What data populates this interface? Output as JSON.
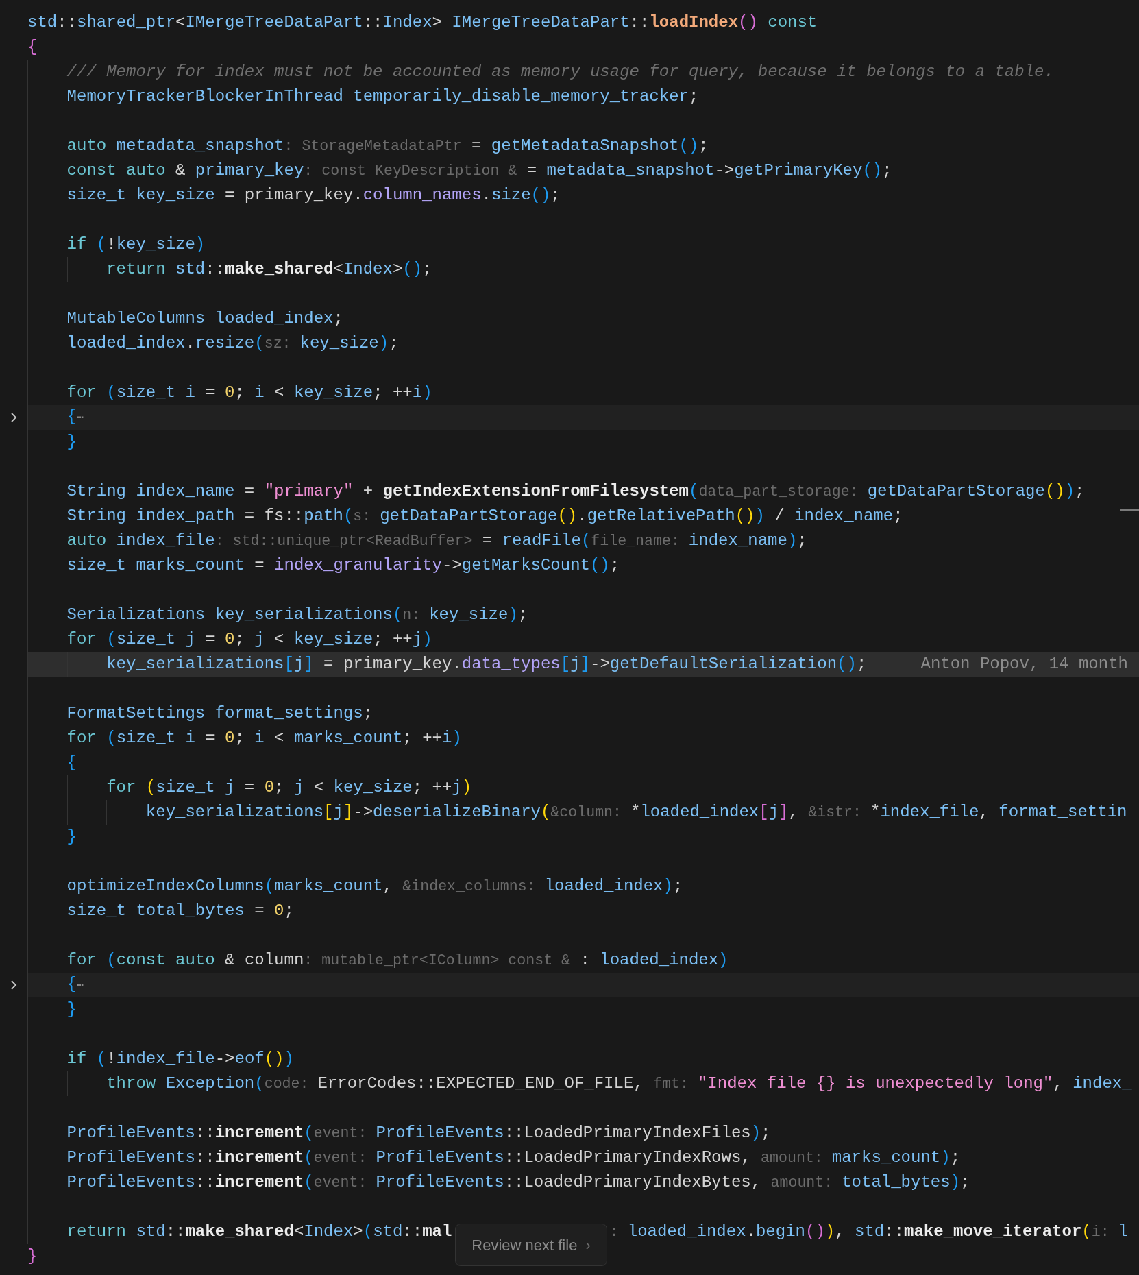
{
  "editor": {
    "lines": [
      {
        "kind": "code",
        "current": false,
        "tokens": [
          {
            "text": "std",
            "kind": "id"
          },
          {
            "text": "::",
            "kind": "p"
          },
          {
            "text": "shared_ptr",
            "kind": "id"
          },
          {
            "text": "<",
            "kind": "p"
          },
          {
            "text": "IMergeTreeDataPart",
            "kind": "id"
          },
          {
            "text": "::",
            "kind": "p"
          },
          {
            "text": "Index",
            "kind": "id"
          },
          {
            "text": "> ",
            "kind": "p"
          },
          {
            "text": "IMergeTreeDataPart",
            "kind": "id"
          },
          {
            "text": "::",
            "kind": "p"
          },
          {
            "text": "loadIndex",
            "kind": "decl"
          },
          {
            "text": "()",
            "kind": "bp"
          },
          {
            "text": " const",
            "kind": "kw"
          }
        ]
      },
      {
        "kind": "code",
        "current": false,
        "tokens": [
          {
            "text": "{",
            "kind": "bp"
          }
        ]
      },
      {
        "kind": "code",
        "current": false,
        "tokens": [
          {
            "text": "    /// Memory for index must not be accounted as memory usage for query, because it belongs to a table.",
            "kind": "cm"
          }
        ]
      },
      {
        "kind": "code",
        "current": false,
        "tokens": [
          {
            "text": "    MemoryTrackerBlockerInThread temporarily_disable_memory_tracker",
            "kind": "id"
          },
          {
            "text": ";",
            "kind": "p"
          }
        ]
      },
      {
        "kind": "blank",
        "current": false
      },
      {
        "kind": "code",
        "current": false,
        "tokens": [
          {
            "text": "    auto",
            "kind": "kw"
          },
          {
            "text": " metadata_snapshot",
            "kind": "id"
          },
          {
            "text": ": StorageMetadataPtr",
            "kind": "hint"
          },
          {
            "text": " = ",
            "kind": "p"
          },
          {
            "text": "getMetadataSnapshot",
            "kind": "id"
          },
          {
            "text": "()",
            "kind": "bb"
          },
          {
            "text": ";",
            "kind": "p"
          }
        ]
      },
      {
        "kind": "code",
        "current": false,
        "tokens": [
          {
            "text": "    const auto",
            "kind": "kw"
          },
          {
            "text": " & ",
            "kind": "p"
          },
          {
            "text": "primary_key",
            "kind": "id"
          },
          {
            "text": ": const KeyDescription &",
            "kind": "hint"
          },
          {
            "text": " = ",
            "kind": "p"
          },
          {
            "text": "metadata_snapshot",
            "kind": "id"
          },
          {
            "text": "->",
            "kind": "p"
          },
          {
            "text": "getPrimaryKey",
            "kind": "id"
          },
          {
            "text": "()",
            "kind": "bb"
          },
          {
            "text": ";",
            "kind": "p"
          }
        ]
      },
      {
        "kind": "code",
        "current": false,
        "tokens": [
          {
            "text": "    size_t key_size",
            "kind": "id"
          },
          {
            "text": " = primary_key.",
            "kind": "p"
          },
          {
            "text": "column_names",
            "kind": "mem"
          },
          {
            "text": ".",
            "kind": "p"
          },
          {
            "text": "size",
            "kind": "id"
          },
          {
            "text": "()",
            "kind": "bb"
          },
          {
            "text": ";",
            "kind": "p"
          }
        ]
      },
      {
        "kind": "blank",
        "current": false
      },
      {
        "kind": "code",
        "current": false,
        "tokens": [
          {
            "text": "    if",
            "kind": "kw"
          },
          {
            "text": " (",
            "kind": "bb"
          },
          {
            "text": "!",
            "kind": "p"
          },
          {
            "text": "key_size",
            "kind": "id"
          },
          {
            "text": ")",
            "kind": "bb"
          }
        ]
      },
      {
        "kind": "code",
        "current": false,
        "tokens": [
          {
            "text": "        return",
            "kind": "kw"
          },
          {
            "text": " std",
            "kind": "id"
          },
          {
            "text": "::",
            "kind": "p"
          },
          {
            "text": "make_shared",
            "kind": "fnb"
          },
          {
            "text": "<",
            "kind": "p"
          },
          {
            "text": "Index",
            "kind": "id"
          },
          {
            "text": ">",
            "kind": "p"
          },
          {
            "text": "()",
            "kind": "bb"
          },
          {
            "text": ";",
            "kind": "p"
          }
        ]
      },
      {
        "kind": "blank",
        "current": false
      },
      {
        "kind": "code",
        "current": false,
        "tokens": [
          {
            "text": "    MutableColumns loaded_index",
            "kind": "id"
          },
          {
            "text": ";",
            "kind": "p"
          }
        ]
      },
      {
        "kind": "code",
        "current": false,
        "tokens": [
          {
            "text": "    loaded_index",
            "kind": "id"
          },
          {
            "text": ".",
            "kind": "p"
          },
          {
            "text": "resize",
            "kind": "id"
          },
          {
            "text": "(",
            "kind": "bb"
          },
          {
            "text": "sz: ",
            "kind": "hint"
          },
          {
            "text": "key_size",
            "kind": "id"
          },
          {
            "text": ")",
            "kind": "bb"
          },
          {
            "text": ";",
            "kind": "p"
          }
        ]
      },
      {
        "kind": "blank",
        "current": false
      },
      {
        "kind": "code",
        "current": false,
        "tokens": [
          {
            "text": "    for",
            "kind": "kw"
          },
          {
            "text": " (",
            "kind": "bb"
          },
          {
            "text": "size_t i",
            "kind": "id"
          },
          {
            "text": " = ",
            "kind": "p"
          },
          {
            "text": "0",
            "kind": "num"
          },
          {
            "text": "; ",
            "kind": "p"
          },
          {
            "text": "i",
            "kind": "id"
          },
          {
            "text": " < ",
            "kind": "p"
          },
          {
            "text": "key_size",
            "kind": "id"
          },
          {
            "text": "; ++",
            "kind": "p"
          },
          {
            "text": "i",
            "kind": "id"
          },
          {
            "text": ")",
            "kind": "bb"
          }
        ]
      },
      {
        "kind": "folded",
        "current": false,
        "tokens": [
          {
            "text": "    {",
            "kind": "bb"
          },
          {
            "text": "⋯",
            "kind": "fold"
          }
        ]
      },
      {
        "kind": "code",
        "current": false,
        "tokens": [
          {
            "text": "    }",
            "kind": "bb"
          }
        ]
      },
      {
        "kind": "blank",
        "current": false
      },
      {
        "kind": "code",
        "current": false,
        "tokens": [
          {
            "text": "    String index_name",
            "kind": "id"
          },
          {
            "text": " = ",
            "kind": "p"
          },
          {
            "text": "\"primary\"",
            "kind": "str"
          },
          {
            "text": " + ",
            "kind": "p"
          },
          {
            "text": "getIndexExtensionFromFilesystem",
            "kind": "fnb"
          },
          {
            "text": "(",
            "kind": "bb"
          },
          {
            "text": "data_part_storage: ",
            "kind": "hint"
          },
          {
            "text": "getDataPartStorage",
            "kind": "id"
          },
          {
            "text": "()",
            "kind": "by"
          },
          {
            "text": ")",
            "kind": "bb"
          },
          {
            "text": ";",
            "kind": "p"
          }
        ]
      },
      {
        "kind": "code",
        "current": false,
        "tokens": [
          {
            "text": "    String index_path",
            "kind": "id"
          },
          {
            "text": " = fs::",
            "kind": "p"
          },
          {
            "text": "path",
            "kind": "id"
          },
          {
            "text": "(",
            "kind": "bb"
          },
          {
            "text": "s: ",
            "kind": "hint"
          },
          {
            "text": "getDataPartStorage",
            "kind": "id"
          },
          {
            "text": "()",
            "kind": "by"
          },
          {
            "text": ".",
            "kind": "p"
          },
          {
            "text": "getRelativePath",
            "kind": "id"
          },
          {
            "text": "()",
            "kind": "by"
          },
          {
            "text": ")",
            "kind": "bb"
          },
          {
            "text": " / ",
            "kind": "p"
          },
          {
            "text": "index_name",
            "kind": "id"
          },
          {
            "text": ";",
            "kind": "p"
          }
        ]
      },
      {
        "kind": "code",
        "current": false,
        "tokens": [
          {
            "text": "    auto",
            "kind": "kw"
          },
          {
            "text": " index_file",
            "kind": "id"
          },
          {
            "text": ": std::unique_ptr<ReadBuffer>",
            "kind": "hint"
          },
          {
            "text": " = ",
            "kind": "p"
          },
          {
            "text": "readFile",
            "kind": "id"
          },
          {
            "text": "(",
            "kind": "bb"
          },
          {
            "text": "file_name: ",
            "kind": "hint"
          },
          {
            "text": "index_name",
            "kind": "id"
          },
          {
            "text": ")",
            "kind": "bb"
          },
          {
            "text": ";",
            "kind": "p"
          }
        ]
      },
      {
        "kind": "code",
        "current": false,
        "tokens": [
          {
            "text": "    size_t marks_count",
            "kind": "id"
          },
          {
            "text": " = ",
            "kind": "p"
          },
          {
            "text": "index_granularity",
            "kind": "mem"
          },
          {
            "text": "->",
            "kind": "p"
          },
          {
            "text": "getMarksCount",
            "kind": "id"
          },
          {
            "text": "()",
            "kind": "bb"
          },
          {
            "text": ";",
            "kind": "p"
          }
        ]
      },
      {
        "kind": "blank",
        "current": false
      },
      {
        "kind": "code",
        "current": false,
        "tokens": [
          {
            "text": "    Serializations key_serializations",
            "kind": "id"
          },
          {
            "text": "(",
            "kind": "bb"
          },
          {
            "text": "n: ",
            "kind": "hint"
          },
          {
            "text": "key_size",
            "kind": "id"
          },
          {
            "text": ")",
            "kind": "bb"
          },
          {
            "text": ";",
            "kind": "p"
          }
        ]
      },
      {
        "kind": "code",
        "current": false,
        "tokens": [
          {
            "text": "    for",
            "kind": "kw"
          },
          {
            "text": " (",
            "kind": "bb"
          },
          {
            "text": "size_t j",
            "kind": "id"
          },
          {
            "text": " = ",
            "kind": "p"
          },
          {
            "text": "0",
            "kind": "num"
          },
          {
            "text": "; ",
            "kind": "p"
          },
          {
            "text": "j",
            "kind": "id"
          },
          {
            "text": " < ",
            "kind": "p"
          },
          {
            "text": "key_size",
            "kind": "id"
          },
          {
            "text": "; ++",
            "kind": "p"
          },
          {
            "text": "j",
            "kind": "id"
          },
          {
            "text": ")",
            "kind": "bb"
          }
        ]
      },
      {
        "kind": "code",
        "current": true,
        "blame": "Anton Popov, 14 month",
        "tokens": [
          {
            "text": "        key_serializations",
            "kind": "id"
          },
          {
            "text": "[",
            "kind": "bb"
          },
          {
            "text": "j",
            "kind": "id"
          },
          {
            "text": "]",
            "kind": "bb"
          },
          {
            "text": " = primary_key.",
            "kind": "p"
          },
          {
            "text": "data_types",
            "kind": "mem"
          },
          {
            "text": "[",
            "kind": "bb"
          },
          {
            "text": "j",
            "kind": "id"
          },
          {
            "text": "]",
            "kind": "bb"
          },
          {
            "text": "->",
            "kind": "p"
          },
          {
            "text": "getDefaultSerialization",
            "kind": "id"
          },
          {
            "text": "()",
            "kind": "bb"
          },
          {
            "text": ";",
            "kind": "p"
          }
        ]
      },
      {
        "kind": "blank",
        "current": false
      },
      {
        "kind": "code",
        "current": false,
        "tokens": [
          {
            "text": "    FormatSettings format_settings",
            "kind": "id"
          },
          {
            "text": ";",
            "kind": "p"
          }
        ]
      },
      {
        "kind": "code",
        "current": false,
        "tokens": [
          {
            "text": "    for",
            "kind": "kw"
          },
          {
            "text": " (",
            "kind": "bb"
          },
          {
            "text": "size_t i",
            "kind": "id"
          },
          {
            "text": " = ",
            "kind": "p"
          },
          {
            "text": "0",
            "kind": "num"
          },
          {
            "text": "; ",
            "kind": "p"
          },
          {
            "text": "i",
            "kind": "id"
          },
          {
            "text": " < ",
            "kind": "p"
          },
          {
            "text": "marks_count",
            "kind": "id"
          },
          {
            "text": "; ++",
            "kind": "p"
          },
          {
            "text": "i",
            "kind": "id"
          },
          {
            "text": ")",
            "kind": "bb"
          }
        ]
      },
      {
        "kind": "code",
        "current": false,
        "tokens": [
          {
            "text": "    {",
            "kind": "bb"
          }
        ]
      },
      {
        "kind": "code",
        "current": false,
        "tokens": [
          {
            "text": "        for",
            "kind": "kw"
          },
          {
            "text": " (",
            "kind": "by"
          },
          {
            "text": "size_t j",
            "kind": "id"
          },
          {
            "text": " = ",
            "kind": "p"
          },
          {
            "text": "0",
            "kind": "num"
          },
          {
            "text": "; ",
            "kind": "p"
          },
          {
            "text": "j",
            "kind": "id"
          },
          {
            "text": " < ",
            "kind": "p"
          },
          {
            "text": "key_size",
            "kind": "id"
          },
          {
            "text": "; ++",
            "kind": "p"
          },
          {
            "text": "j",
            "kind": "id"
          },
          {
            "text": ")",
            "kind": "by"
          }
        ]
      },
      {
        "kind": "code",
        "current": false,
        "tokens": [
          {
            "text": "            key_serializations",
            "kind": "id"
          },
          {
            "text": "[",
            "kind": "by"
          },
          {
            "text": "j",
            "kind": "id"
          },
          {
            "text": "]",
            "kind": "by"
          },
          {
            "text": "->",
            "kind": "p"
          },
          {
            "text": "deserializeBinary",
            "kind": "id"
          },
          {
            "text": "(",
            "kind": "by"
          },
          {
            "text": "&column: ",
            "kind": "hint"
          },
          {
            "text": "*",
            "kind": "p"
          },
          {
            "text": "loaded_index",
            "kind": "id"
          },
          {
            "text": "[",
            "kind": "bp"
          },
          {
            "text": "j",
            "kind": "id"
          },
          {
            "text": "]",
            "kind": "bp"
          },
          {
            "text": ", ",
            "kind": "p"
          },
          {
            "text": "&istr: ",
            "kind": "hint"
          },
          {
            "text": "*",
            "kind": "p"
          },
          {
            "text": "index_file",
            "kind": "id"
          },
          {
            "text": ", ",
            "kind": "p"
          },
          {
            "text": "format_settin",
            "kind": "id"
          }
        ]
      },
      {
        "kind": "code",
        "current": false,
        "tokens": [
          {
            "text": "    }",
            "kind": "bb"
          }
        ]
      },
      {
        "kind": "blank",
        "current": false
      },
      {
        "kind": "code",
        "current": false,
        "tokens": [
          {
            "text": "    optimizeIndexColumns",
            "kind": "id"
          },
          {
            "text": "(",
            "kind": "bb"
          },
          {
            "text": "marks_count",
            "kind": "id"
          },
          {
            "text": ", ",
            "kind": "p"
          },
          {
            "text": "&index_columns: ",
            "kind": "hint"
          },
          {
            "text": "loaded_index",
            "kind": "id"
          },
          {
            "text": ")",
            "kind": "bb"
          },
          {
            "text": ";",
            "kind": "p"
          }
        ]
      },
      {
        "kind": "code",
        "current": false,
        "tokens": [
          {
            "text": "    size_t total_bytes",
            "kind": "id"
          },
          {
            "text": " = ",
            "kind": "p"
          },
          {
            "text": "0",
            "kind": "num"
          },
          {
            "text": ";",
            "kind": "p"
          }
        ]
      },
      {
        "kind": "blank",
        "current": false
      },
      {
        "kind": "code",
        "current": false,
        "tokens": [
          {
            "text": "    for",
            "kind": "kw"
          },
          {
            "text": " (",
            "kind": "bb"
          },
          {
            "text": "const auto",
            "kind": "kw"
          },
          {
            "text": " & column",
            "kind": "p"
          },
          {
            "text": ": mutable_ptr<IColumn> const &",
            "kind": "hint"
          },
          {
            "text": " : ",
            "kind": "p"
          },
          {
            "text": "loaded_index",
            "kind": "id"
          },
          {
            "text": ")",
            "kind": "bb"
          }
        ]
      },
      {
        "kind": "folded",
        "current": false,
        "tokens": [
          {
            "text": "    {",
            "kind": "bb"
          },
          {
            "text": "⋯",
            "kind": "fold"
          }
        ]
      },
      {
        "kind": "code",
        "current": false,
        "tokens": [
          {
            "text": "    }",
            "kind": "bb"
          }
        ]
      },
      {
        "kind": "blank",
        "current": false
      },
      {
        "kind": "code",
        "current": false,
        "tokens": [
          {
            "text": "    if",
            "kind": "kw"
          },
          {
            "text": " (",
            "kind": "bb"
          },
          {
            "text": "!",
            "kind": "p"
          },
          {
            "text": "index_file",
            "kind": "id"
          },
          {
            "text": "->",
            "kind": "p"
          },
          {
            "text": "eof",
            "kind": "id"
          },
          {
            "text": "()",
            "kind": "by"
          },
          {
            "text": ")",
            "kind": "bb"
          }
        ]
      },
      {
        "kind": "code",
        "current": false,
        "tokens": [
          {
            "text": "        throw",
            "kind": "kw"
          },
          {
            "text": " Exception",
            "kind": "id"
          },
          {
            "text": "(",
            "kind": "bb"
          },
          {
            "text": "code: ",
            "kind": "hint"
          },
          {
            "text": "ErrorCodes::EXPECTED_END_OF_FILE, ",
            "kind": "p"
          },
          {
            "text": "fmt: ",
            "kind": "hint"
          },
          {
            "text": "\"Index file {} is unexpectedly long\"",
            "kind": "str"
          },
          {
            "text": ", ",
            "kind": "p"
          },
          {
            "text": "index_",
            "kind": "id"
          }
        ]
      },
      {
        "kind": "blank",
        "current": false
      },
      {
        "kind": "code",
        "current": false,
        "tokens": [
          {
            "text": "    ProfileEvents",
            "kind": "id"
          },
          {
            "text": "::",
            "kind": "p"
          },
          {
            "text": "increment",
            "kind": "fnb"
          },
          {
            "text": "(",
            "kind": "bb"
          },
          {
            "text": "event: ",
            "kind": "hint"
          },
          {
            "text": "ProfileEvents",
            "kind": "id"
          },
          {
            "text": "::LoadedPrimaryIndexFiles",
            "kind": "p"
          },
          {
            "text": ")",
            "kind": "bb"
          },
          {
            "text": ";",
            "kind": "p"
          }
        ]
      },
      {
        "kind": "code",
        "current": false,
        "tokens": [
          {
            "text": "    ProfileEvents",
            "kind": "id"
          },
          {
            "text": "::",
            "kind": "p"
          },
          {
            "text": "increment",
            "kind": "fnb"
          },
          {
            "text": "(",
            "kind": "bb"
          },
          {
            "text": "event: ",
            "kind": "hint"
          },
          {
            "text": "ProfileEvents",
            "kind": "id"
          },
          {
            "text": "::LoadedPrimaryIndexRows, ",
            "kind": "p"
          },
          {
            "text": "amount: ",
            "kind": "hint"
          },
          {
            "text": "marks_count",
            "kind": "id"
          },
          {
            "text": ")",
            "kind": "bb"
          },
          {
            "text": ";",
            "kind": "p"
          }
        ]
      },
      {
        "kind": "code",
        "current": false,
        "tokens": [
          {
            "text": "    ProfileEvents",
            "kind": "id"
          },
          {
            "text": "::",
            "kind": "p"
          },
          {
            "text": "increment",
            "kind": "fnb"
          },
          {
            "text": "(",
            "kind": "bb"
          },
          {
            "text": "event: ",
            "kind": "hint"
          },
          {
            "text": "ProfileEvents",
            "kind": "id"
          },
          {
            "text": "::LoadedPrimaryIndexBytes, ",
            "kind": "p"
          },
          {
            "text": "amount: ",
            "kind": "hint"
          },
          {
            "text": "total_bytes",
            "kind": "id"
          },
          {
            "text": ")",
            "kind": "bb"
          },
          {
            "text": ";",
            "kind": "p"
          }
        ]
      },
      {
        "kind": "blank",
        "current": false
      },
      {
        "kind": "code",
        "current": false,
        "tokens": [
          {
            "text": "    return",
            "kind": "kw"
          },
          {
            "text": " std",
            "kind": "id"
          },
          {
            "text": "::",
            "kind": "p"
          },
          {
            "text": "make_shared",
            "kind": "fnb"
          },
          {
            "text": "<",
            "kind": "p"
          },
          {
            "text": "Index",
            "kind": "id"
          },
          {
            "text": ">",
            "kind": "p"
          },
          {
            "text": "(",
            "kind": "bb"
          },
          {
            "text": "std",
            "kind": "id"
          },
          {
            "text": "::",
            "kind": "p"
          },
          {
            "text": "mal",
            "kind": "fnb"
          }
        ],
        "after_gap": [
          {
            "text": ": ",
            "kind": "hint"
          },
          {
            "text": "loaded_index",
            "kind": "id"
          },
          {
            "text": ".",
            "kind": "p"
          },
          {
            "text": "begin",
            "kind": "id"
          },
          {
            "text": "()",
            "kind": "bp"
          },
          {
            "text": ")",
            "kind": "by"
          },
          {
            "text": ", ",
            "kind": "p"
          },
          {
            "text": "std",
            "kind": "id"
          },
          {
            "text": "::",
            "kind": "p"
          },
          {
            "text": "make_move_iterator",
            "kind": "fnb"
          },
          {
            "text": "(",
            "kind": "by"
          },
          {
            "text": "i: ",
            "kind": "hint"
          },
          {
            "text": "l",
            "kind": "id"
          }
        ]
      },
      {
        "kind": "code",
        "current": false,
        "tokens": [
          {
            "text": "}",
            "kind": "bp"
          }
        ]
      }
    ]
  },
  "review_button": {
    "label": "Review next file",
    "chevron": "›"
  }
}
